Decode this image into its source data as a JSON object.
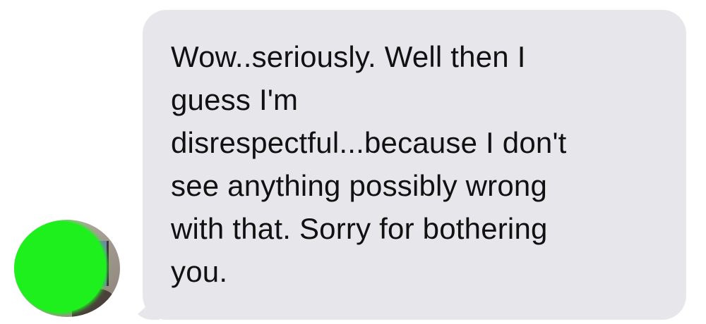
{
  "conversation": {
    "message": {
      "lines": [
        "Wow..seriously. Well then I",
        "guess I'm",
        "disrespectful...because I don't",
        "see anything possibly wrong",
        "with that. Sorry for bothering",
        "you."
      ],
      "bubble_color": "#e6e6eb",
      "text_color": "#111111"
    },
    "avatar": {
      "icon": "contact-avatar-redacted",
      "redaction_color": "#1ef01e"
    }
  }
}
